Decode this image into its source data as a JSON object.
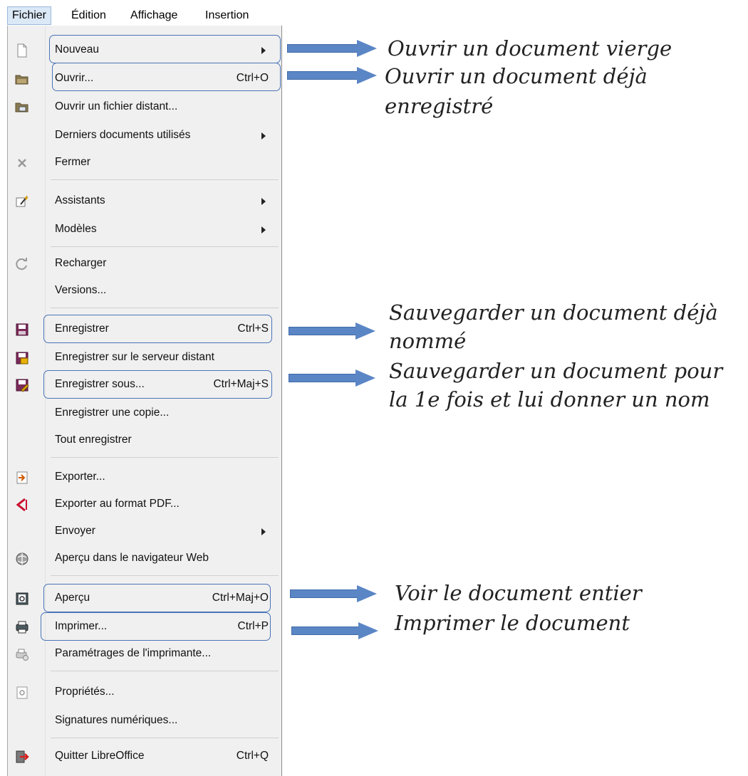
{
  "menubar": {
    "fichier": "Fichier",
    "edition": "Édition",
    "affichage": "Affichage",
    "insertion": "Insertion"
  },
  "menu": {
    "nouveau": "Nouveau",
    "ouvrir": "Ouvrir...",
    "ouvrir_shortcut": "Ctrl+O",
    "ouvrir_distant": "Ouvrir un fichier distant...",
    "derniers": "Derniers documents utilisés",
    "fermer": "Fermer",
    "assistants": "Assistants",
    "modeles": "Modèles",
    "recharger": "Recharger",
    "versions": "Versions...",
    "enregistrer": "Enregistrer",
    "enregistrer_shortcut": "Ctrl+S",
    "enregistrer_serveur": "Enregistrer sur le serveur distant",
    "enregistrer_sous": "Enregistrer sous...",
    "enregistrer_sous_shortcut": "Ctrl+Maj+S",
    "enregistrer_copie": "Enregistrer une copie...",
    "tout_enregistrer": "Tout enregistrer",
    "exporter": "Exporter...",
    "exporter_pdf": "Exporter au format PDF...",
    "envoyer": "Envoyer",
    "apercu_web": "Aperçu dans le navigateur Web",
    "apercu": "Aperçu",
    "apercu_shortcut": "Ctrl+Maj+O",
    "imprimer": "Imprimer...",
    "imprimer_shortcut": "Ctrl+P",
    "parametrages": "Paramétrages de l'imprimante...",
    "proprietes": "Propriétés...",
    "signatures": "Signatures numériques...",
    "quitter": "Quitter LibreOffice",
    "quitter_shortcut": "Ctrl+Q"
  },
  "notes": {
    "nouveau": "Ouvrir un document vierge",
    "ouvrir_l1": "Ouvrir un document déjà",
    "ouvrir_l2": "enregistré",
    "enregistrer_l1": "Sauvegarder un document déjà",
    "enregistrer_l2": "nommé",
    "enregistrer_sous_l1": "Sauvegarder un document pour",
    "enregistrer_sous_l2": "la 1e fois et lui donner un nom",
    "apercu": "Voir le document entier",
    "imprimer": "Imprimer le document"
  },
  "icons": {
    "new": "new-document-icon",
    "open": "folder-open-icon",
    "open_remote": "remote-folder-icon",
    "close": "close-icon",
    "wizards": "wizard-icon",
    "reload": "reload-icon",
    "save": "save-icon",
    "save_remote": "save-remote-icon",
    "save_as": "save-as-icon",
    "export": "export-icon",
    "export_pdf": "pdf-icon",
    "web_preview": "web-preview-icon",
    "preview": "print-preview-icon",
    "print": "printer-icon",
    "printer_settings": "printer-settings-icon",
    "properties": "properties-icon",
    "quit": "quit-icon"
  },
  "colors": {
    "highlight_border": "#4a74b8",
    "arrow_fill": "#5b86c5",
    "menubar_active": "#dbe8f6"
  }
}
